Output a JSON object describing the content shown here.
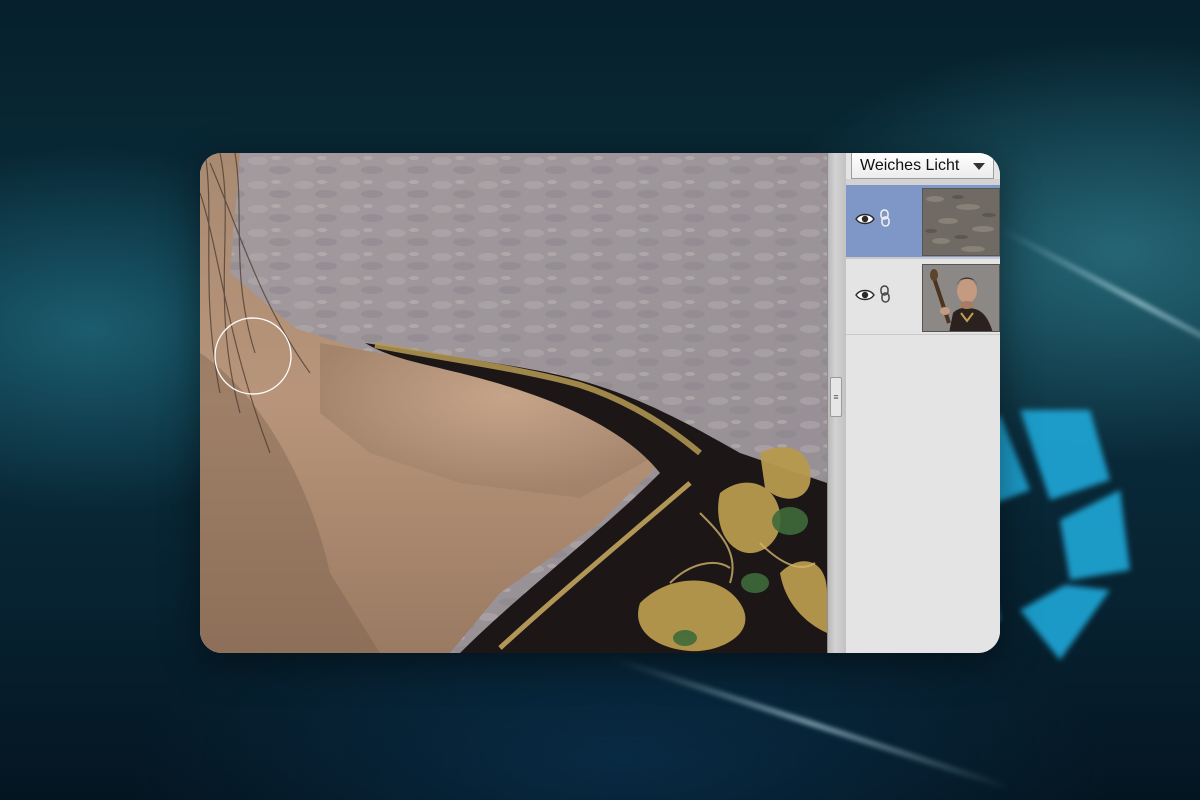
{
  "app": {
    "blend_mode": {
      "selected": "Weiches Licht"
    }
  },
  "layers": [
    {
      "name": "texture-layer",
      "visible": true,
      "selected": true,
      "icon": "eye-icon"
    },
    {
      "name": "portrait-layer",
      "visible": true,
      "selected": false,
      "icon": "eye-icon"
    }
  ],
  "colors": {
    "selection": "#7e97c7",
    "panel": "#e4e4e4"
  }
}
